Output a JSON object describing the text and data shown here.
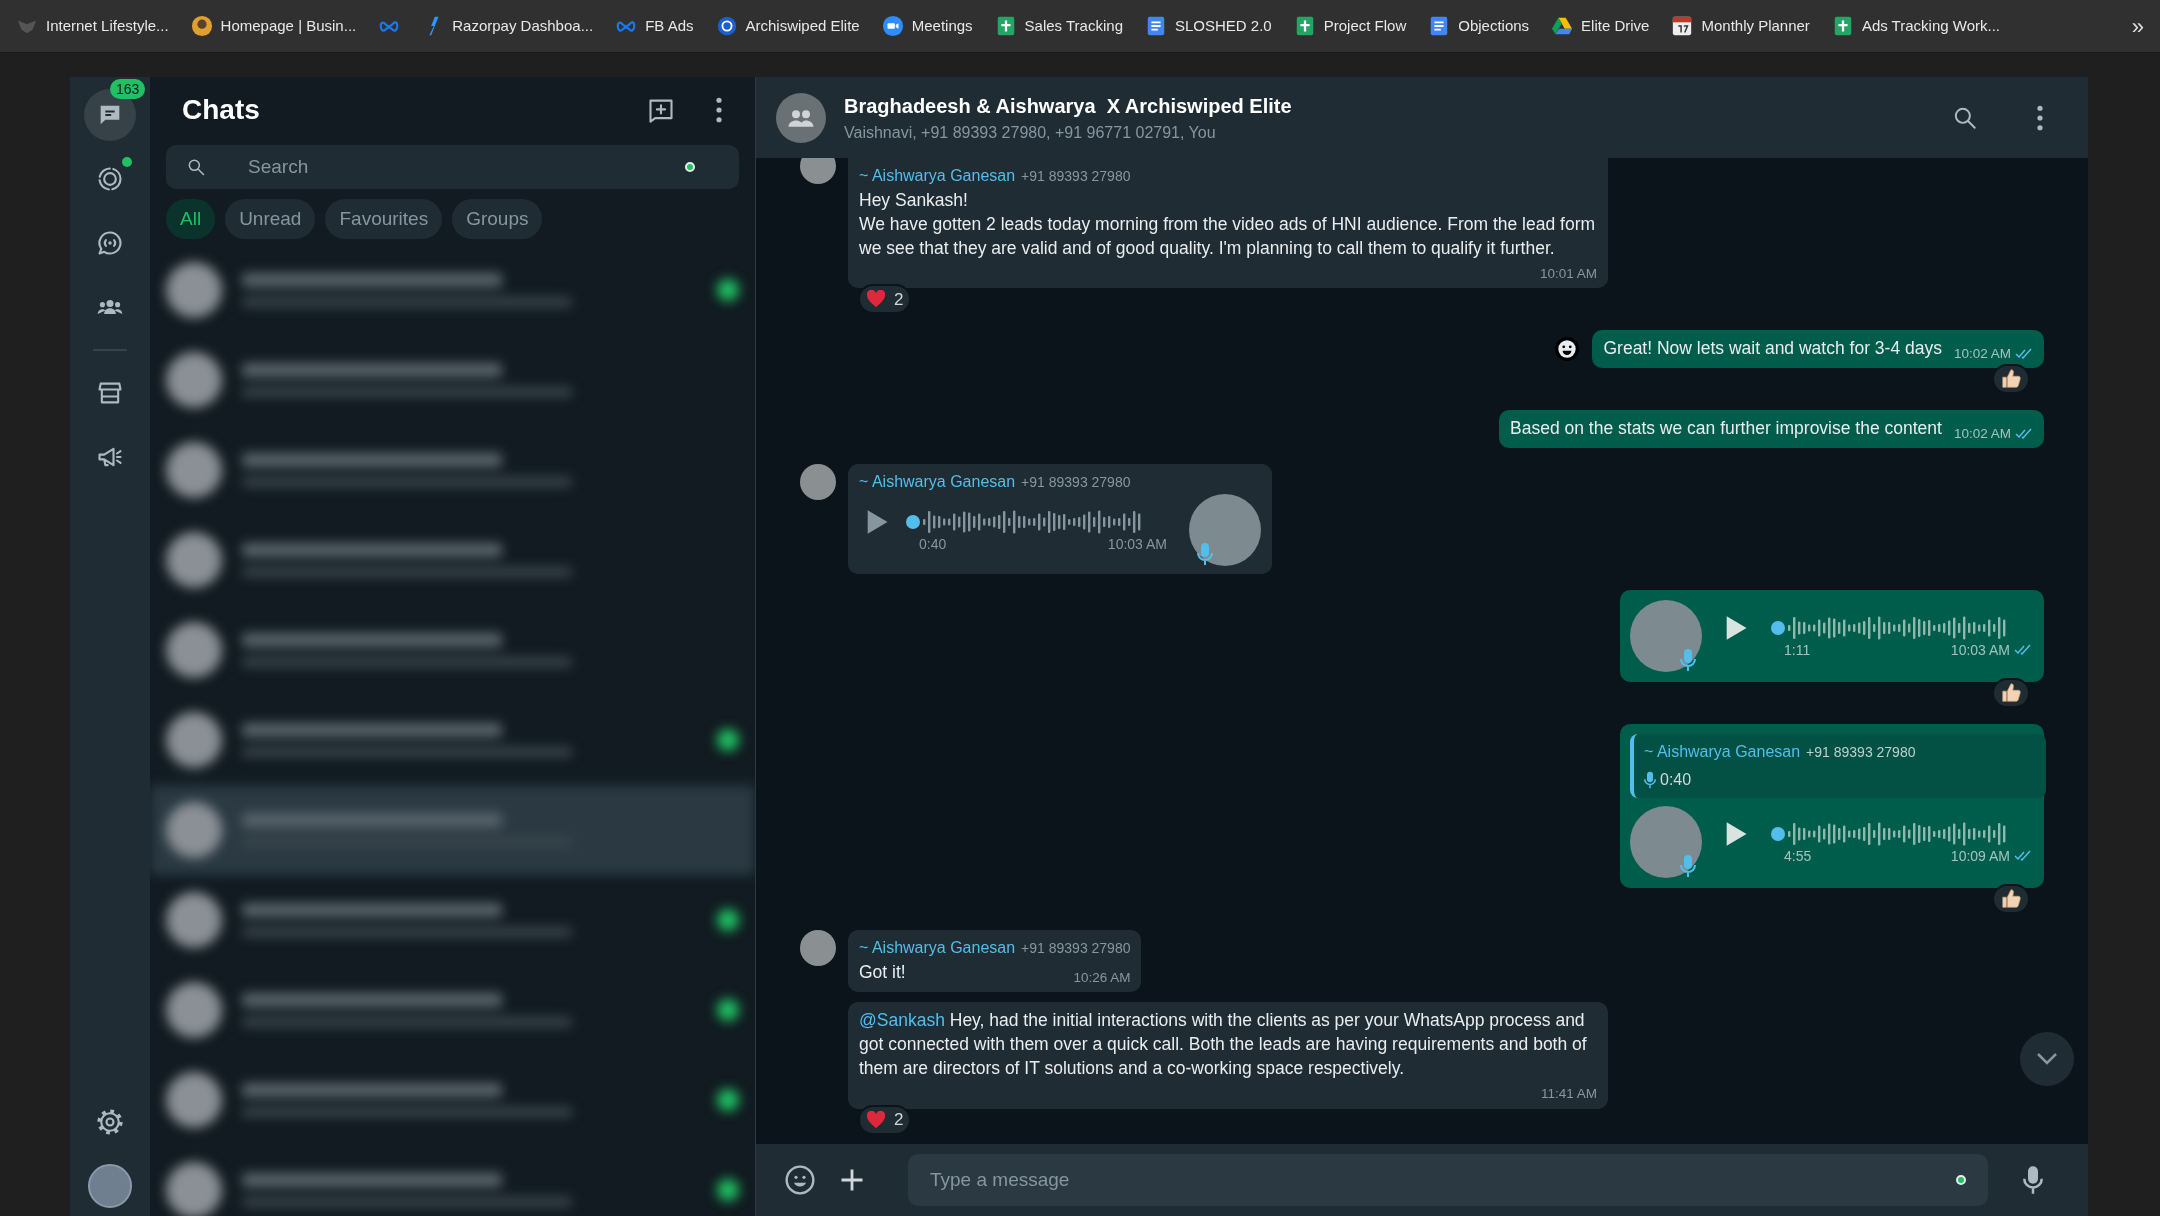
{
  "bookmarks": [
    {
      "label": "Internet Lifestyle..."
    },
    {
      "label": "Homepage | Busin..."
    },
    {
      "label": "Razorpay Dashboa..."
    },
    {
      "label": "FB Ads"
    },
    {
      "label": "Archiswiped Elite"
    },
    {
      "label": "Meetings"
    },
    {
      "label": "Sales Tracking"
    },
    {
      "label": "SLOSHED 2.0"
    },
    {
      "label": "Project Flow"
    },
    {
      "label": "Objections"
    },
    {
      "label": "Elite Drive"
    },
    {
      "label": "Monthly Planner"
    },
    {
      "label": "Ads Tracking Work..."
    }
  ],
  "bookmarks_overflow": "»",
  "nav": {
    "top": [
      {
        "kind": "chats",
        "selected": true,
        "badge": "163",
        "dot": false
      },
      {
        "kind": "status",
        "selected": false,
        "dot": true
      },
      {
        "kind": "channels",
        "selected": false,
        "dot": false
      },
      {
        "kind": "communities",
        "selected": false,
        "dot": false
      },
      {
        "kind": "store",
        "selected": false,
        "dot": false
      },
      {
        "kind": "megaphone",
        "selected": false,
        "dot": false
      }
    ],
    "bottom": [
      {
        "kind": "settings"
      },
      {
        "kind": "profile"
      }
    ]
  },
  "chat_list": {
    "title": "Chats",
    "search": {
      "placeholder": "Search"
    },
    "filters": [
      {
        "label": "All",
        "selected": true
      },
      {
        "label": "Unread",
        "selected": false
      },
      {
        "label": "Favourites",
        "selected": false
      },
      {
        "label": "Groups",
        "selected": false
      }
    ],
    "rows": [
      {
        "selected": false,
        "unread": true
      },
      {
        "selected": false,
        "unread": false
      },
      {
        "selected": false,
        "unread": false
      },
      {
        "selected": false,
        "unread": false
      },
      {
        "selected": false,
        "unread": false
      },
      {
        "selected": false,
        "unread": true
      },
      {
        "selected": true,
        "unread": false
      },
      {
        "selected": false,
        "unread": true
      },
      {
        "selected": false,
        "unread": true
      },
      {
        "selected": false,
        "unread": true
      },
      {
        "selected": false,
        "unread": true
      }
    ]
  },
  "chat": {
    "title": "Braghadeesh & Aishwarya  X Archiswiped Elite",
    "subtitle": "Vaishnavi, +91 89393 27980, +91 96771 02791, You",
    "messages": [
      {
        "kind": "incoming-text",
        "avatar": true,
        "sender": "~ Aishwarya Ganesan",
        "phone": "+91 89393 27980",
        "text": "Hey Sankash!\nWe have gotten 2 leads today morning from the video ads of HNI audience. From the lead form we see that they are valid and of good quality. I'm planning to call them to qualify it further.",
        "time": "10:01 AM",
        "reaction": {
          "kind": "heart",
          "count": "2"
        }
      },
      {
        "kind": "outgoing-text",
        "react_button": true,
        "text": "Great! Now lets wait and watch for 3-4 days",
        "time": "10:02 AM",
        "read": true,
        "reaction": {
          "kind": "thumbs-up"
        }
      },
      {
        "kind": "outgoing-text",
        "react_button": false,
        "text": "Based on the stats we can further improvise the content",
        "time": "10:02 AM",
        "read": true
      },
      {
        "kind": "incoming-voice",
        "avatar": true,
        "sender": "~ Aishwarya Ganesan",
        "phone": "+91 89393 27980",
        "duration": "0:40",
        "time": "10:03 AM"
      },
      {
        "kind": "outgoing-voice",
        "duration": "1:11",
        "time": "10:03 AM",
        "read": true,
        "reaction": {
          "kind": "thumbs-up"
        }
      },
      {
        "kind": "outgoing-voice",
        "quote": {
          "sender": "~ Aishwarya Ganesan",
          "phone": "+91 89393 27980",
          "duration": "0:40"
        },
        "duration": "4:55",
        "time": "10:09 AM",
        "read": true,
        "reaction": {
          "kind": "thumbs-up"
        }
      },
      {
        "kind": "incoming-text",
        "avatar": true,
        "sender": "~ Aishwarya Ganesan",
        "phone": "+91 89393 27980",
        "text": "Got it!",
        "time": "10:26 AM"
      },
      {
        "kind": "incoming-text",
        "avatar": false,
        "mention": "@Sankash",
        "text": "Hey, had the initial interactions with the clients as per your WhatsApp process and got connected with them over a quick call. Both the leads are having requirements and both of them are directors of IT solutions and a co-working space respectively.",
        "time": "11:41 AM",
        "reaction": {
          "kind": "heart",
          "count": "2"
        }
      }
    ]
  },
  "composer": {
    "placeholder": "Type a message"
  }
}
